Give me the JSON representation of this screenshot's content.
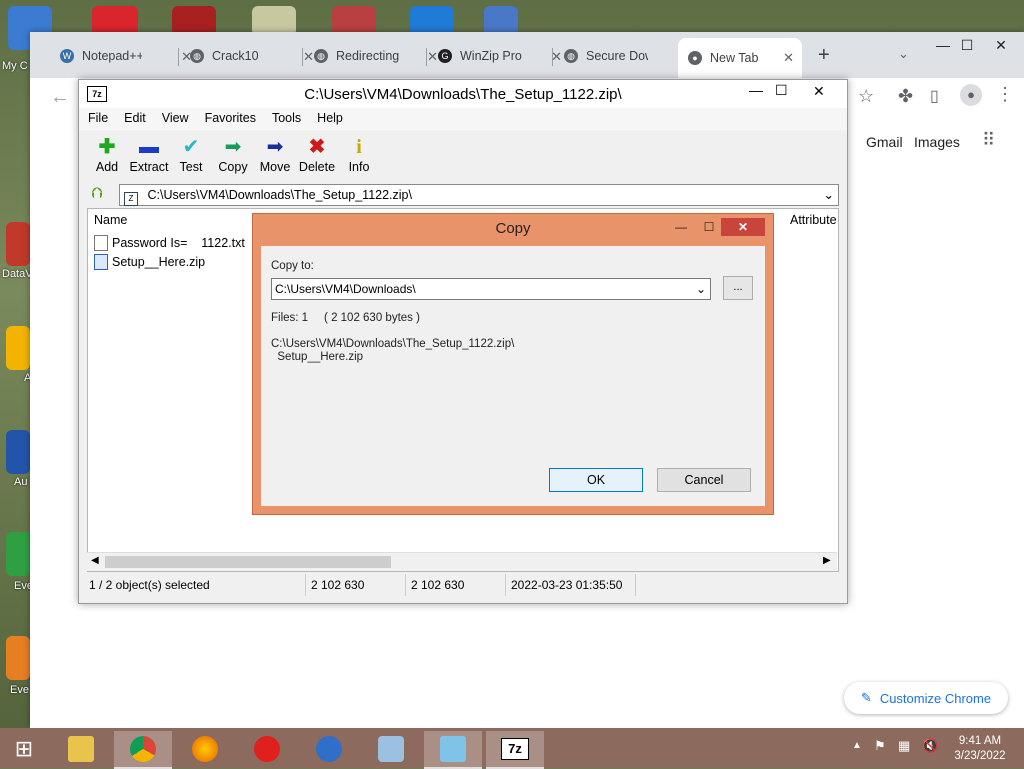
{
  "desktop": {
    "icons": [
      {
        "label": "My C"
      },
      {
        "label": "DataV"
      },
      {
        "label": "A"
      },
      {
        "label": "Au"
      },
      {
        "label": "Eve"
      },
      {
        "label": "Eve"
      }
    ]
  },
  "chrome": {
    "tabs": [
      {
        "label": "Notepad++",
        "icon": "wordpress-icon"
      },
      {
        "label": "Crack10",
        "icon": "globe-icon"
      },
      {
        "label": "Redirecting",
        "icon": "globe-icon"
      },
      {
        "label": "WinZip Pro",
        "icon": "g-icon"
      },
      {
        "label": "Secure Dow",
        "icon": "globe-icon"
      },
      {
        "label": "New Tab",
        "icon": "chrome-icon",
        "active": true
      }
    ],
    "new_tab": "+",
    "links": {
      "gmail": "Gmail",
      "images": "Images"
    },
    "customize_label": "Customize Chrome"
  },
  "sevenzip": {
    "title": "C:\\Users\\VM4\\Downloads\\The_Setup_1122.zip\\",
    "menu": [
      "File",
      "Edit",
      "View",
      "Favorites",
      "Tools",
      "Help"
    ],
    "tools": [
      {
        "label": "Add",
        "color": "#1fa81f"
      },
      {
        "label": "Extract",
        "color": "#1c3cc7"
      },
      {
        "label": "Test",
        "color": "#25b8c9"
      },
      {
        "label": "Copy",
        "color": "#1a9a5a"
      },
      {
        "label": "Move",
        "color": "#1a2f9c"
      },
      {
        "label": "Delete",
        "color": "#d01818"
      },
      {
        "label": "Info",
        "color": "#c9a800"
      }
    ],
    "address": "C:\\Users\\VM4\\Downloads\\The_Setup_1122.zip\\",
    "columns": {
      "name": "Name",
      "attributes": "Attribute"
    },
    "files": [
      {
        "name": "Password Is=    1122.txt"
      },
      {
        "name": "Setup__Here.zip"
      }
    ],
    "status": {
      "selected": "1 / 2 object(s) selected",
      "size": "2 102 630",
      "packed": "2 102 630",
      "modified": "2022-03-23 01:35:50"
    }
  },
  "copy_dialog": {
    "title": "Copy",
    "copy_to_label": "Copy to:",
    "path_value": "C:\\Users\\VM4\\Downloads\\",
    "browse_label": "...",
    "files_info": "Files: 1     ( 2 102 630 bytes )",
    "source_line1": "C:\\Users\\VM4\\Downloads\\The_Setup_1122.zip\\",
    "source_line2": "  Setup__Here.zip",
    "ok_label": "OK",
    "cancel_label": "Cancel"
  },
  "taskbar": {
    "time": "9:41 AM",
    "date": "3/23/2022"
  }
}
